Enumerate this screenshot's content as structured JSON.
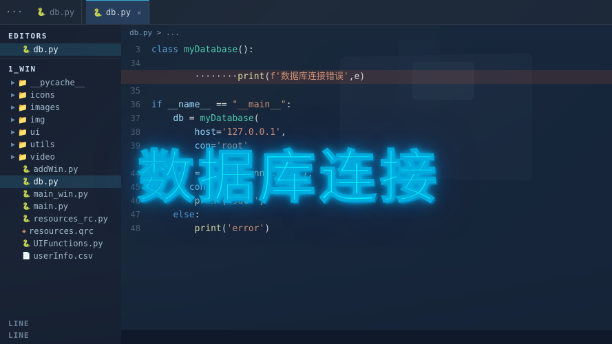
{
  "title_bar": {
    "dots_label": "···",
    "tabs": [
      {
        "id": "tab-dots",
        "label": "···",
        "type": "dots"
      },
      {
        "id": "tab-db",
        "label": "db.py",
        "icon": "🐍",
        "active": true,
        "close": "×"
      }
    ]
  },
  "sidebar": {
    "editors_label": "EDITORS",
    "editors_files": [
      {
        "name": "db.py",
        "icon": "py",
        "active": true
      }
    ],
    "win_label": "1_WIN",
    "folders": [
      {
        "name": "__pycache__",
        "type": "folder"
      },
      {
        "name": "icons",
        "type": "folder"
      },
      {
        "name": "images",
        "type": "folder"
      },
      {
        "name": "img",
        "type": "folder"
      },
      {
        "name": "ui",
        "type": "folder"
      },
      {
        "name": "utils",
        "type": "folder"
      },
      {
        "name": "video",
        "type": "folder"
      }
    ],
    "files": [
      {
        "name": "addWin.py",
        "icon": "py"
      },
      {
        "name": "db.py",
        "icon": "py",
        "active": true
      },
      {
        "name": "main_win.py",
        "icon": "py"
      },
      {
        "name": "main.py",
        "icon": "py"
      },
      {
        "name": "resources_rc.py",
        "icon": "py"
      },
      {
        "name": "resources.qrc",
        "icon": "qrc"
      },
      {
        "name": "UIFunctions.py",
        "icon": "py"
      },
      {
        "name": "userInfo.csv",
        "icon": "csv"
      }
    ],
    "bottom_panels": [
      "LINE",
      "LINE"
    ]
  },
  "breadcrumb": {
    "path": "db.py > ..."
  },
  "code": {
    "lines": [
      {
        "num": "3",
        "content": "class myDatabase():"
      },
      {
        "num": "34",
        "content": ""
      },
      {
        "num": "",
        "content": "        ········print(f'数据库连接错误',e)",
        "highlighted": true
      },
      {
        "num": "35",
        "content": ""
      },
      {
        "num": "36",
        "content": "if __name__ == \"__main__\":"
      },
      {
        "num": "37",
        "content": "    db = myDatabase("
      },
      {
        "num": "38",
        "content": "        host='127.0.0.1',"
      },
      {
        "num": "39",
        "content": "        con='root'"
      },
      {
        "num": "",
        "content": ""
      },
      {
        "num": "44",
        "content": "    con = db.get_connection()"
      },
      {
        "num": "45",
        "content": "    if con:"
      },
      {
        "num": "46",
        "content": "        print('succ')"
      },
      {
        "num": "47",
        "content": "    else:"
      },
      {
        "num": "48",
        "content": "        print('error')"
      }
    ]
  },
  "overlay": {
    "title": "数据库连接"
  },
  "status_bar": {
    "items": []
  }
}
